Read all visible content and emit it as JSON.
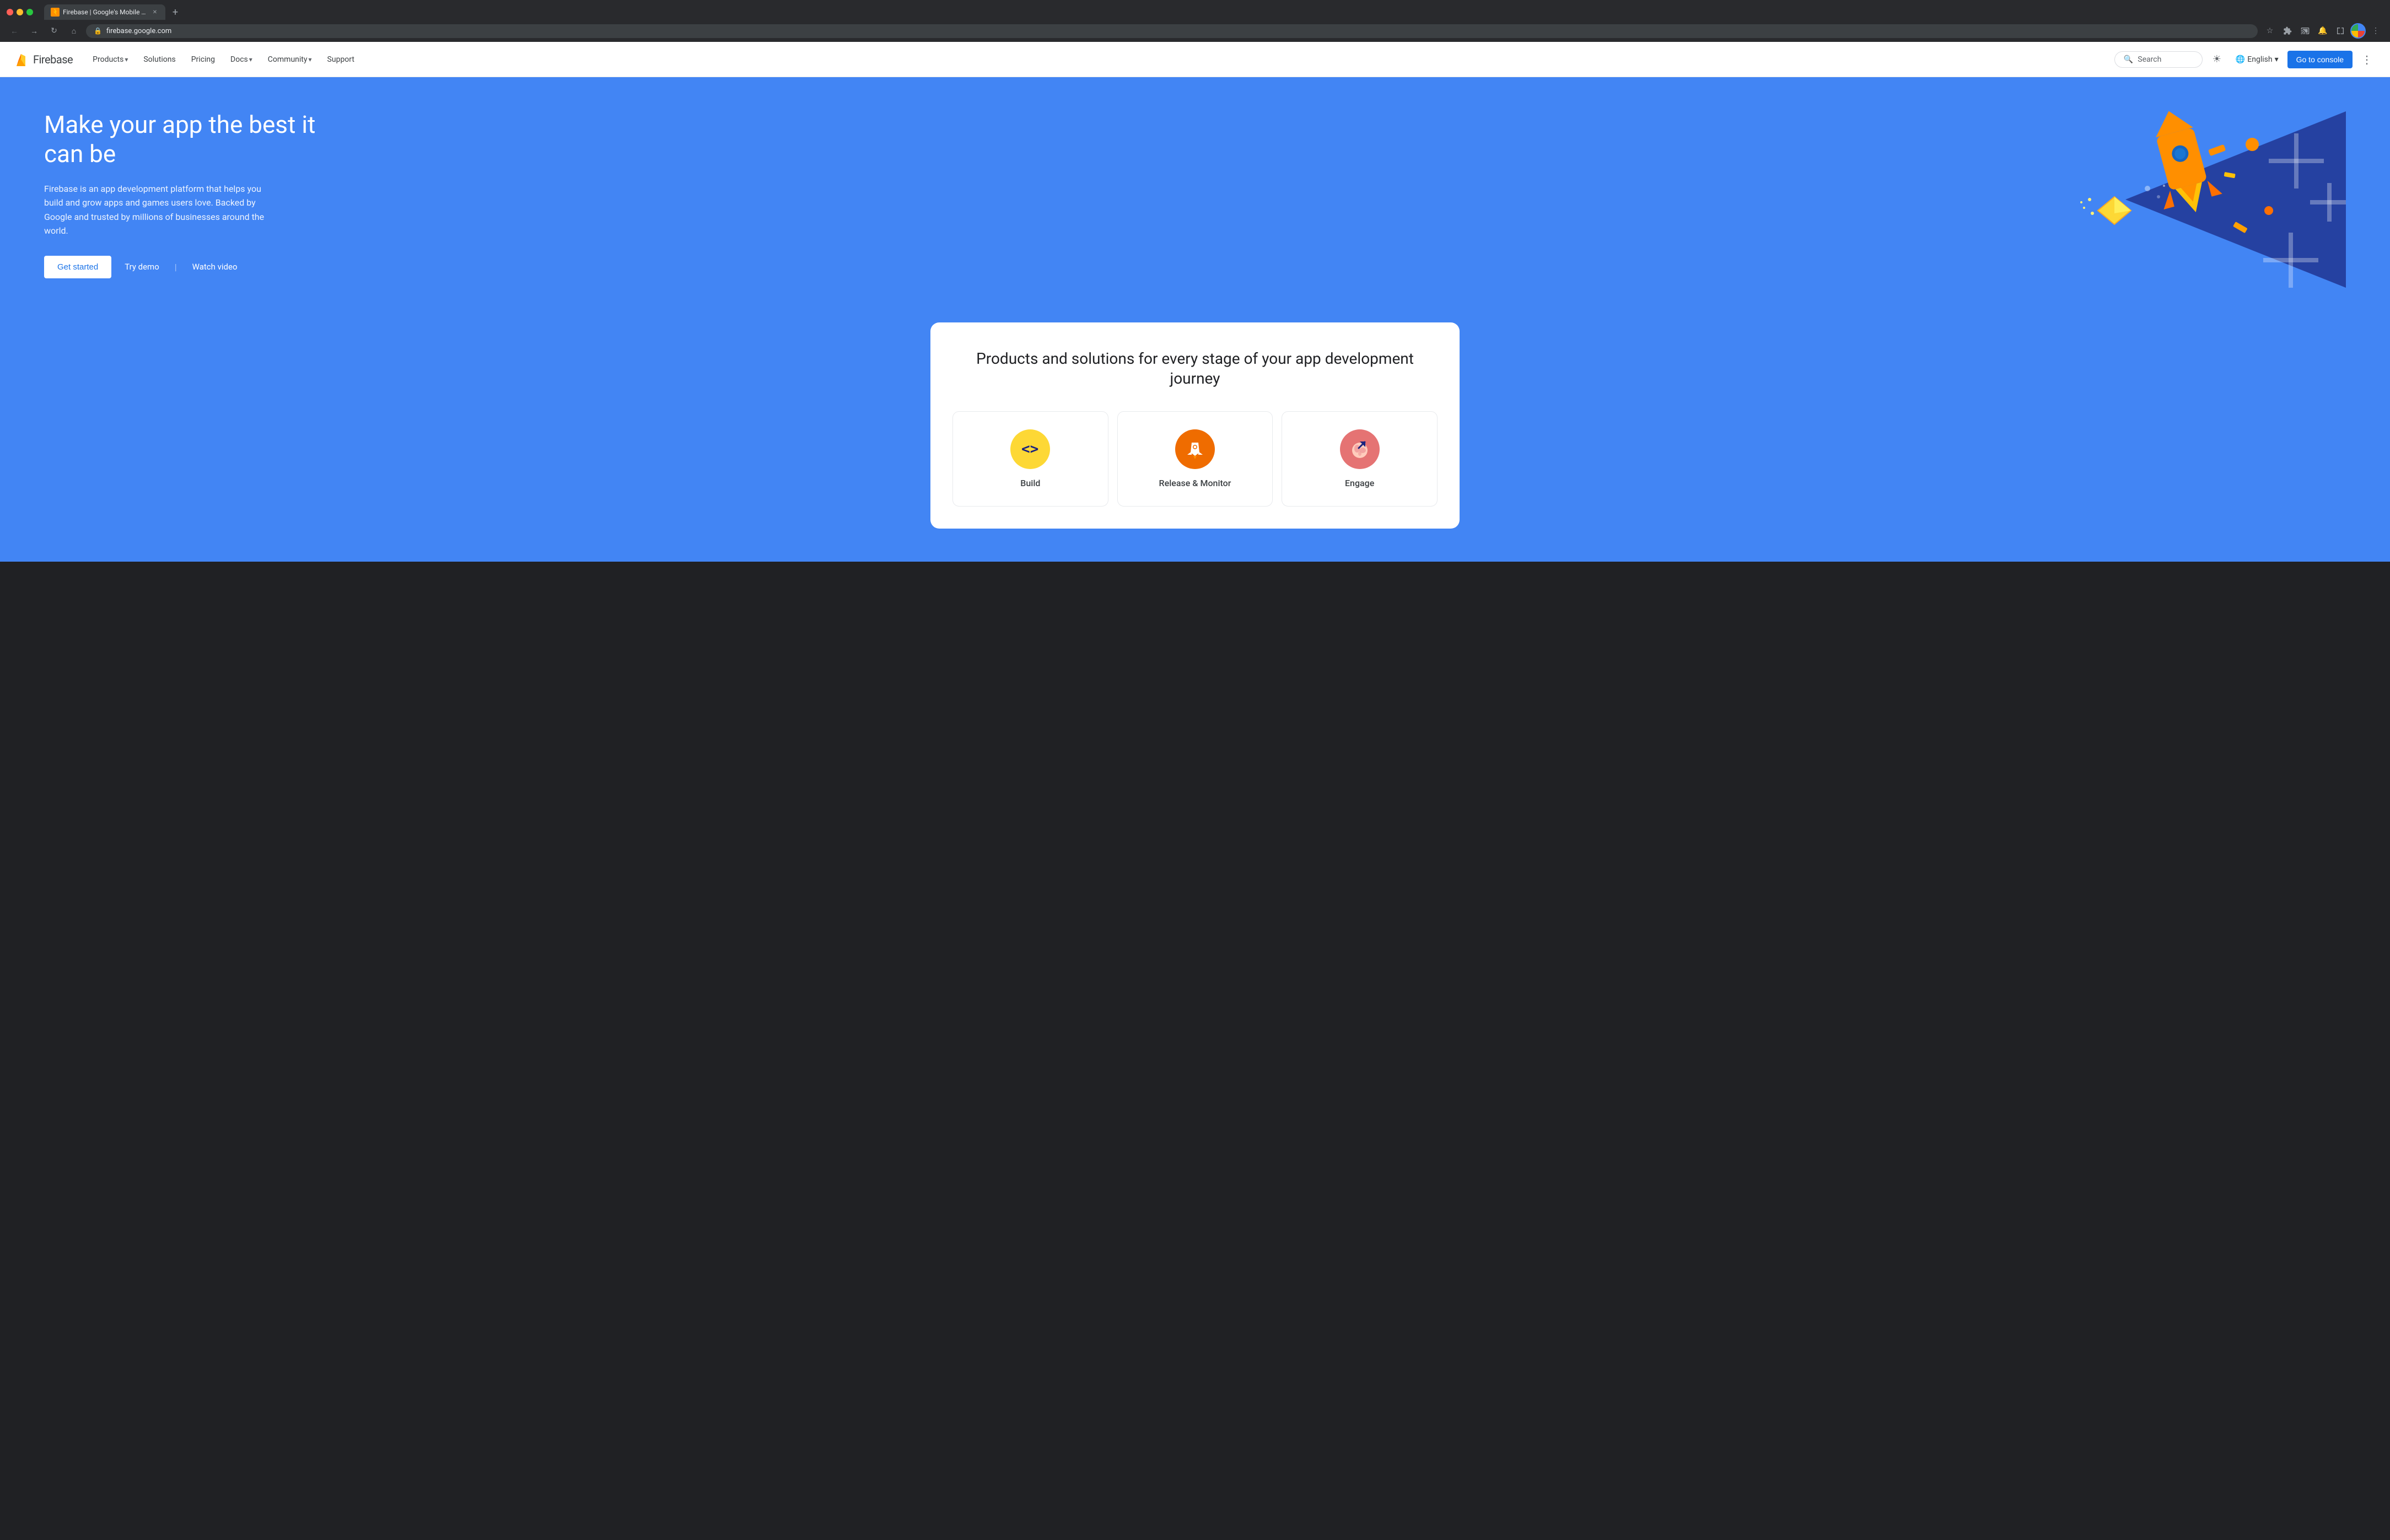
{
  "browser": {
    "traffic_lights": [
      "red",
      "yellow",
      "green"
    ],
    "tab": {
      "title": "Firebase | Google's Mobile &...",
      "favicon_color": "#FF8F00"
    },
    "new_tab_label": "+",
    "address": "firebase.google.com",
    "toolbar_icons": [
      "back",
      "forward",
      "reload",
      "home",
      "address",
      "star",
      "history",
      "extensions",
      "notifications",
      "profile",
      "menu"
    ]
  },
  "nav": {
    "logo_text": "Firebase",
    "items": [
      {
        "label": "Products",
        "has_dropdown": true
      },
      {
        "label": "Solutions",
        "has_dropdown": false
      },
      {
        "label": "Pricing",
        "has_dropdown": false
      },
      {
        "label": "Docs",
        "has_dropdown": true
      },
      {
        "label": "Community",
        "has_dropdown": true
      },
      {
        "label": "Support",
        "has_dropdown": false
      }
    ],
    "search": {
      "placeholder": "Search",
      "label": "Search"
    },
    "language": "English",
    "console_button": "Go to console"
  },
  "hero": {
    "title": "Make your app the best it can be",
    "description": "Firebase is an app development platform that helps you build and grow apps and games users love. Backed by Google and trusted by millions of businesses around the world.",
    "cta_primary": "Get started",
    "cta_secondary": "Try demo",
    "cta_tertiary": "Watch video"
  },
  "products": {
    "section_title": "Products and solutions for every stage of your app development journey",
    "items": [
      {
        "label": "Build",
        "icon_type": "build",
        "icon_color": "#fdd835"
      },
      {
        "label": "Release & Monitor",
        "icon_type": "release",
        "icon_color": "#ef6c00"
      },
      {
        "label": "Engage",
        "icon_type": "engage",
        "icon_color": "#e57373"
      }
    ]
  }
}
